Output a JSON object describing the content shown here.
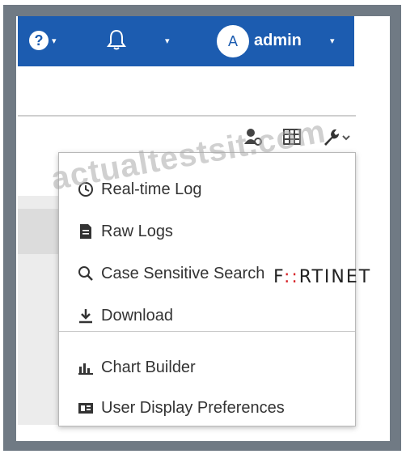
{
  "navbar": {
    "help_icon": "?",
    "bell_icon": "bell-icon",
    "avatar_letter": "A",
    "username": "admin",
    "caret": "▾"
  },
  "menu": {
    "items": [
      {
        "label": "Real-time Log",
        "icon": "clock-icon"
      },
      {
        "label": "Raw Logs",
        "icon": "document-icon"
      },
      {
        "label": "Case Sensitive Search",
        "icon": "search-case-icon"
      },
      {
        "label": "Download",
        "icon": "download-icon"
      },
      {
        "label": "Chart Builder",
        "icon": "chart-icon"
      },
      {
        "label": "User Display Preferences",
        "icon": "display-preferences-icon"
      }
    ]
  },
  "watermark": "actualtestsit.com",
  "brand": {
    "prefix": "F",
    "accent": "::",
    "suffix": "RTINET"
  },
  "colors": {
    "navbar": "#1c5cb0",
    "frame": "#707a84",
    "brand_accent": "#d7262b"
  }
}
